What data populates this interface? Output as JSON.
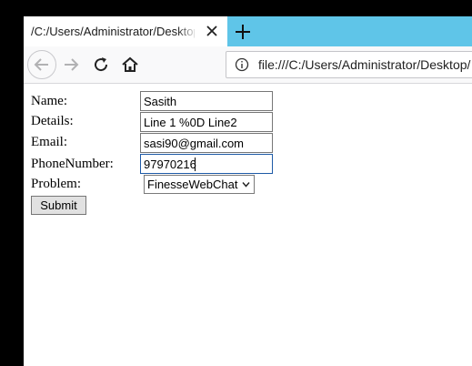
{
  "browser": {
    "tab_title": "/C:/Users/Administrator/Desktop/w",
    "url": "file:///C:/Users/Administrator/Desktop/",
    "icons": {
      "tab_close": "close-icon",
      "new_tab": "plus-icon",
      "back": "back-arrow-icon",
      "forward": "forward-arrow-icon",
      "reload": "reload-icon",
      "home": "home-icon",
      "site_info": "info-icon"
    },
    "colors": {
      "tabstrip": "#5fc5e8",
      "navbar": "#f9f9fa"
    }
  },
  "form": {
    "labels": {
      "name": "Name:",
      "details": "Details:",
      "email": "Email:",
      "phone": "PhoneNumber:",
      "problem": "Problem:"
    },
    "values": {
      "name": "Sasith",
      "details": "Line 1 %0D Line2",
      "email": "sasi90@gmail.com",
      "phone": "97970216"
    },
    "problem_selected": "FinesseWebChat",
    "submit_label": "Submit"
  }
}
